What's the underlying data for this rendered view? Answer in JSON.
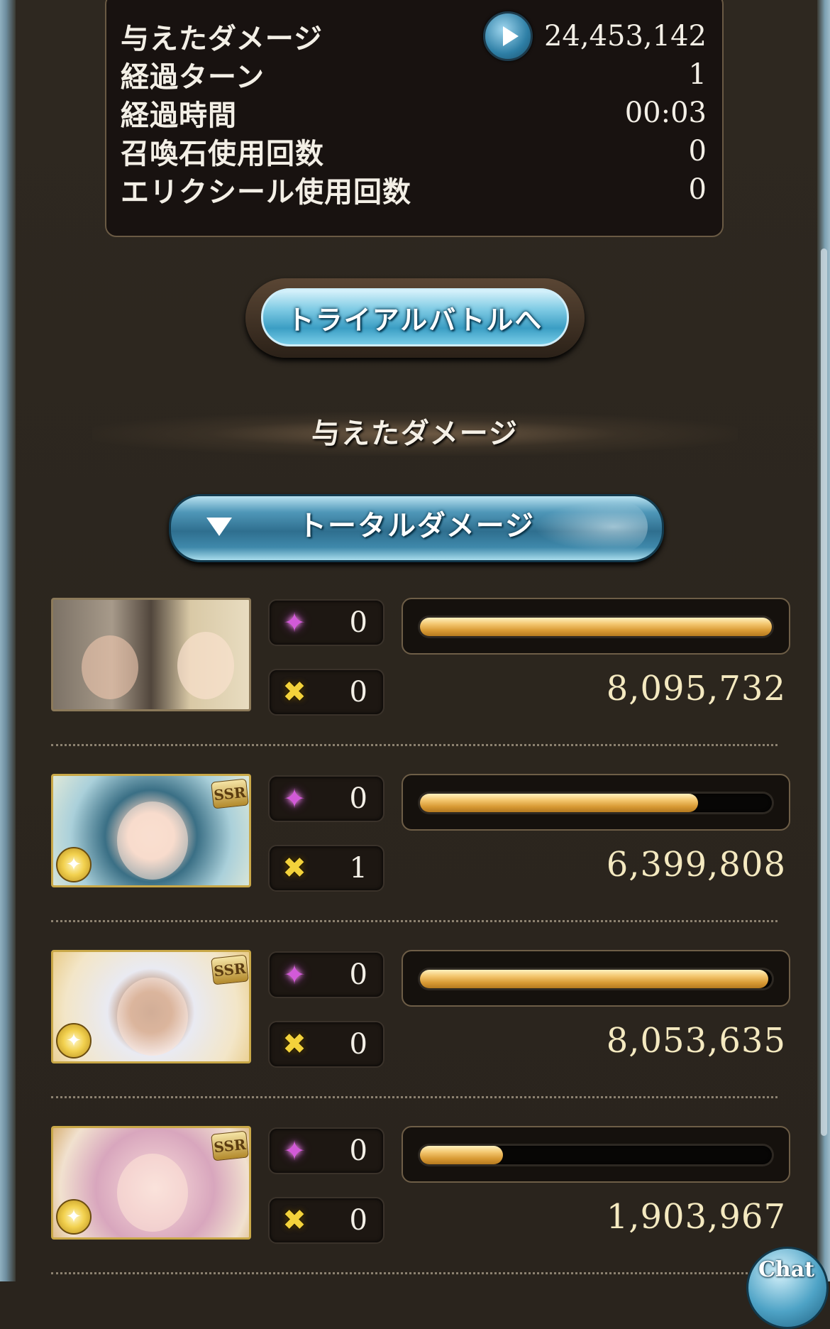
{
  "summary": {
    "damage_label": "与えたダメージ",
    "damage_value": "24,453,142",
    "turns_label": "経過ターン",
    "turns_value": "1",
    "time_label": "経過時間",
    "time_value": "00:03",
    "summon_label": "召喚石使用回数",
    "summon_value": "0",
    "elixir_label": "エリクシール使用回数",
    "elixir_value": "0"
  },
  "trial_button_label": "トライアルバトルへ",
  "section_heading": "与えたダメージ",
  "dropdown": {
    "selected": "トータルダメージ"
  },
  "members": [
    {
      "star_count": "0",
      "ca_count": "0",
      "damage": "8,095,732",
      "bar_fraction": 1.0,
      "ssr": "",
      "portrait": "duo"
    },
    {
      "star_count": "0",
      "ca_count": "1",
      "damage": "6,399,808",
      "bar_fraction": 0.79,
      "ssr": "SSR",
      "portrait": "blue"
    },
    {
      "star_count": "0",
      "ca_count": "0",
      "damage": "8,053,635",
      "bar_fraction": 0.99,
      "ssr": "SSR",
      "portrait": "white"
    },
    {
      "star_count": "0",
      "ca_count": "0",
      "damage": "1,903,967",
      "bar_fraction": 0.235,
      "ssr": "SSR",
      "portrait": "pink"
    }
  ],
  "chat_label": "Chat",
  "colors": {
    "bar_gold": "#f3c66e",
    "button_blue": "#3b9ec4",
    "panel": "#2a241d"
  },
  "icons": {
    "star": "star-burst-icon",
    "cross": "crossed-swords-icon",
    "play": "play-icon",
    "element": "light-element-icon"
  }
}
